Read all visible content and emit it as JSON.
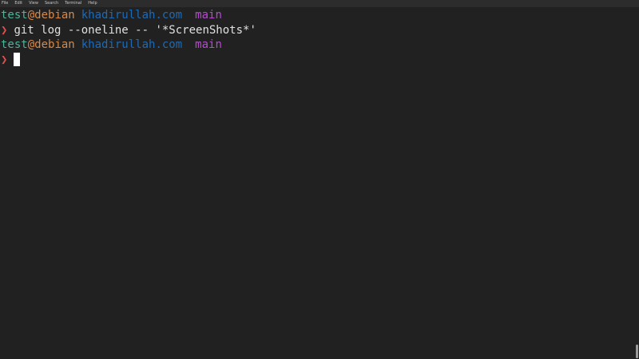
{
  "menu": {
    "items": [
      "File",
      "Edit",
      "View",
      "Search",
      "Terminal",
      "Help"
    ]
  },
  "terminal": {
    "line1": {
      "user": "test",
      "at": "@",
      "host": "debian",
      "directory": "khadirullah.com",
      "branch": "main"
    },
    "line2": {
      "prompt_symbol": "❯",
      "command": "git log --oneline -- '*ScreenShots*'"
    },
    "line3": {
      "user": "test",
      "at": "@",
      "host": "debian",
      "directory": "khadirullah.com",
      "branch": "main"
    },
    "line4": {
      "prompt_symbol": "❯"
    }
  },
  "colors": {
    "background": "#212121",
    "user": "#4fb39a",
    "host": "#d68a4a",
    "directory": "#1e6ab5",
    "branch": "#b64ad0",
    "prompt": "#e0504a",
    "text": "#e0e0e0"
  }
}
